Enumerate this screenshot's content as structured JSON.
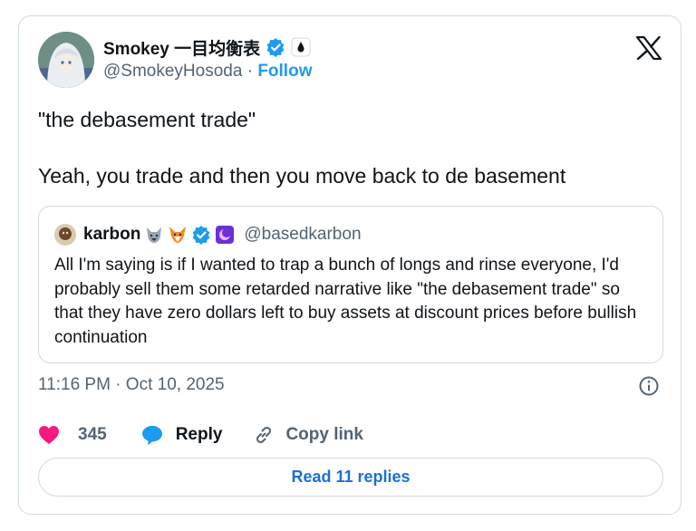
{
  "author": {
    "name": "Smokey 一目均衡表",
    "handle": "@SmokeyHosoda",
    "separator": "·",
    "follow_label": "Follow"
  },
  "tweet": {
    "paragraphs": [
      "\"the debasement trade\"",
      "Yeah, you trade and then you move back to de basement"
    ],
    "timestamp": "11:16 PM · Oct 10, 2025"
  },
  "quote": {
    "name": "karbon",
    "handle": "@basedkarbon",
    "text": "All I'm saying is if I wanted to trap a bunch of longs and rinse everyone, I'd probably sell them some retarded narrative like \"the debasement trade\" so that they have zero dollars left to buy assets at discount prices before bullish continuation"
  },
  "actions": {
    "like_count": "345",
    "reply_label": "Reply",
    "copy_label": "Copy link"
  },
  "read_replies_label": "Read 11 replies",
  "icons": {
    "verified": "verified-badge-icon",
    "x_logo": "x-logo-icon",
    "like": "heart-icon",
    "reply": "reply-bubble-icon",
    "copy": "link-icon",
    "info": "info-icon"
  },
  "colors": {
    "accent": "#1d9bf0",
    "like": "#f91880",
    "muted": "#536471",
    "border": "#cfd9de"
  }
}
